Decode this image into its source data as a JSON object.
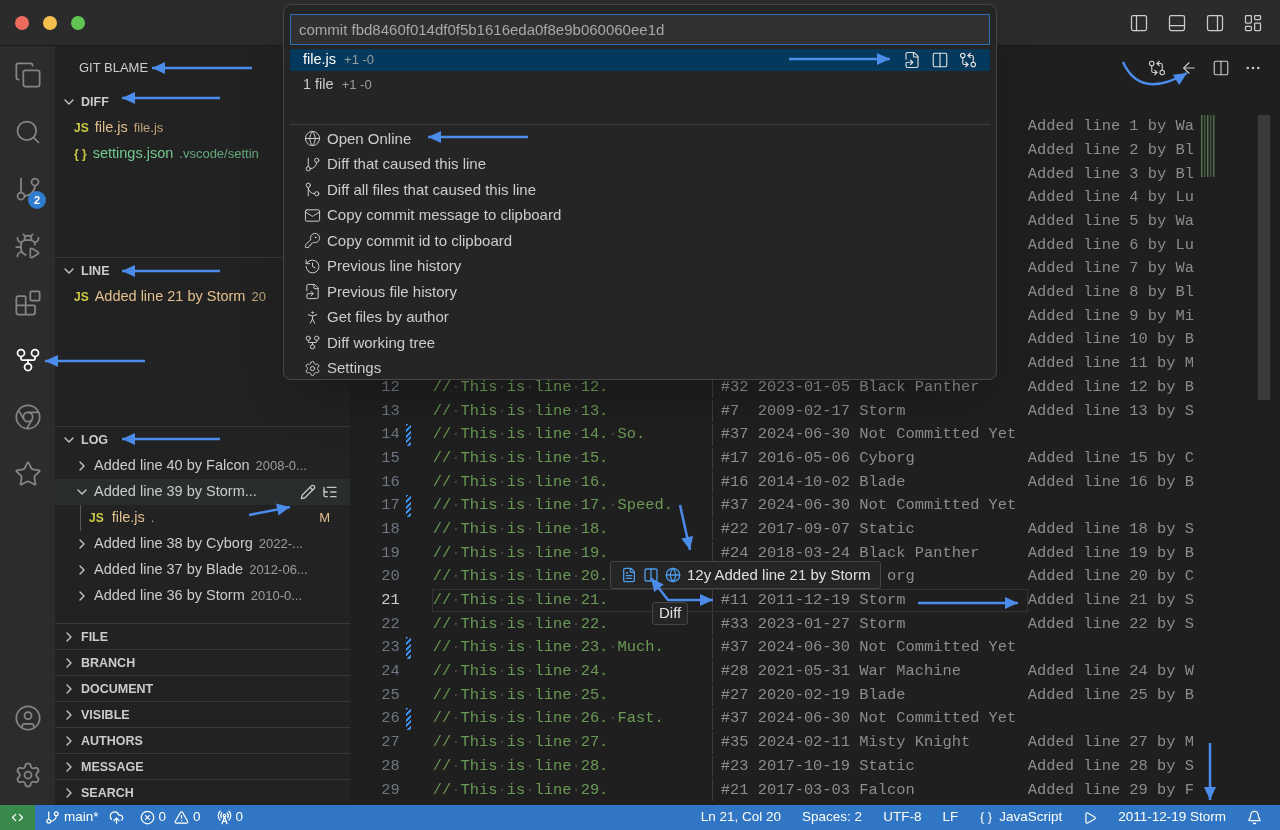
{
  "activity_bar": [
    {
      "kind": "files",
      "selected": false
    },
    {
      "kind": "search",
      "selected": false
    },
    {
      "kind": "source-control",
      "selected": false,
      "badge": "2"
    },
    {
      "kind": "run-debug",
      "selected": false
    },
    {
      "kind": "extensions",
      "selected": false
    },
    {
      "kind": "git-fork",
      "selected": true
    },
    {
      "kind": "ring",
      "selected": false
    },
    {
      "kind": "star",
      "selected": false
    }
  ],
  "activity_bar_bottom": [
    {
      "kind": "account"
    },
    {
      "kind": "settings"
    }
  ],
  "sidebar": {
    "title": "GIT BLAME",
    "sections": [
      {
        "title": "DIFF",
        "kind": "files",
        "expanded": true,
        "items": [
          {
            "icon": "JS",
            "name": "file.js",
            "detail": "file.js",
            "color": "#e2c08d"
          },
          {
            "icon": "{ }",
            "name": "settings.json",
            "detail": ".vscode/settin",
            "color": "#73c991"
          }
        ]
      },
      {
        "title": "LINE",
        "kind": "files",
        "expanded": true,
        "items": [
          {
            "icon": "JS",
            "name": "Added line 21 by Storm",
            "detail": "20",
            "color": "#e2c08d"
          }
        ]
      },
      {
        "title": "LOG",
        "kind": "commits",
        "expanded": true,
        "items": [
          {
            "label": "Added line 40 by Falcon",
            "detail": "2008-0...",
            "expanded": false,
            "selected": false
          },
          {
            "label": "Added line 39 by Storm...",
            "expanded": true,
            "selected": true,
            "children": [
              {
                "icon": "JS",
                "name": "file.js",
                "detail": ".",
                "status": "M"
              }
            ]
          },
          {
            "label": "Added line 38 by Cyborg",
            "detail": "2022-...",
            "expanded": false,
            "selected": false
          },
          {
            "label": "Added line 37 by Blade",
            "detail": "2012-06...",
            "expanded": false,
            "selected": false
          },
          {
            "label": "Added line 36 by Storm",
            "detail": "2010-0...",
            "expanded": false,
            "selected": false
          }
        ]
      },
      {
        "title": "FILE",
        "expanded": false
      },
      {
        "title": "BRANCH",
        "expanded": false
      },
      {
        "title": "DOCUMENT",
        "expanded": false
      },
      {
        "title": "VISIBLE",
        "expanded": false
      },
      {
        "title": "AUTHORS",
        "expanded": false
      },
      {
        "title": "MESSAGE",
        "expanded": false
      },
      {
        "title": "SEARCH",
        "expanded": false
      }
    ]
  },
  "command_palette": {
    "value": "commit fbd8460f014df0f5b1616eda0f8e9b060060ee1d",
    "files": [
      {
        "name": "file.js",
        "stats": "+1 -0",
        "selected": true
      },
      {
        "name": "1 file",
        "stats": "+1 -0",
        "selected": false
      }
    ],
    "actions": [
      {
        "kind": "globe",
        "label": "Open Online"
      },
      {
        "kind": "branch",
        "label": "Diff that caused this line"
      },
      {
        "kind": "merge",
        "label": "Diff all files that caused this line"
      },
      {
        "kind": "mail",
        "label": "Copy commit message to clipboard"
      },
      {
        "kind": "key",
        "label": "Copy commit id to clipboard"
      },
      {
        "kind": "history",
        "label": "Previous line history"
      },
      {
        "kind": "file-history",
        "label": "Previous file history"
      },
      {
        "kind": "person",
        "label": "Get files by author"
      },
      {
        "kind": "fork",
        "label": "Diff working tree"
      },
      {
        "kind": "settings",
        "label": "Settings"
      }
    ]
  },
  "editor": {
    "lines": [
      {
        "message": "Added line 1 by Wa"
      },
      {
        "message": "Added line 2 by Bl"
      },
      {
        "message": "Added line 3 by Bl"
      },
      {
        "message": "Added line 4 by Lu"
      },
      {
        "message": "Added line 5 by Wa"
      },
      {
        "message": "Added line 6 by Lu"
      },
      {
        "message": "Added line 7 by Wa"
      },
      {
        "message": "Added line 8 by Bl"
      },
      {
        "message": "Added line 9 by Mi"
      },
      {
        "message": "Added line 10 by B"
      },
      {
        "message": "Added line 11 by M"
      },
      {
        "number": "12",
        "code": "//·This·is·line·12.",
        "modified": false,
        "current": false,
        "blame": {
          "hash": "#32",
          "date": "2023-01-05",
          "author": "Black Panther"
        },
        "message": "Added line 12 by B"
      },
      {
        "number": "13",
        "code": "//·This·is·line·13.",
        "modified": false,
        "current": false,
        "blame": {
          "hash": "#7",
          "date": "2009-02-17",
          "author": "Storm"
        },
        "message": "Added line 13 by S"
      },
      {
        "number": "14",
        "code": "//·This·is·line·14.·So.",
        "modified": true,
        "current": false,
        "blame": {
          "hash": "#37",
          "date": "2024-06-30",
          "author": "Not Committed Yet"
        }
      },
      {
        "number": "15",
        "code": "//·This·is·line·15.",
        "modified": false,
        "current": false,
        "blame": {
          "hash": "#17",
          "date": "2016-05-06",
          "author": "Cyborg"
        },
        "message": "Added line 15 by C"
      },
      {
        "number": "16",
        "code": "//·This·is·line·16.",
        "modified": false,
        "current": false,
        "blame": {
          "hash": "#16",
          "date": "2014-10-02",
          "author": "Blade"
        },
        "message": "Added line 16 by B"
      },
      {
        "number": "17",
        "code": "//·This·is·line·17.·Speed.",
        "modified": true,
        "current": false,
        "blame": {
          "hash": "#37",
          "date": "2024-06-30",
          "author": "Not Committed Yet"
        }
      },
      {
        "number": "18",
        "code": "//·This·is·line·18.",
        "modified": false,
        "current": false,
        "blame": {
          "hash": "#22",
          "date": "2017-09-07",
          "author": "Static"
        },
        "message": "Added line 18 by S"
      },
      {
        "number": "19",
        "code": "//·This·is·line·19.",
        "modified": false,
        "current": false,
        "blame": {
          "hash": "#24",
          "date": "2018-03-24",
          "author": "Black Panther"
        },
        "message": "Added line 19 by B"
      },
      {
        "number": "20",
        "code": "//·This·is·line·20.",
        "modified": false,
        "current": false,
        "blame": {
          "author": "org"
        },
        "message": "Added line 20 by C"
      },
      {
        "number": "21",
        "code": "//·This·is·line·21.",
        "modified": false,
        "current": true,
        "blame": {
          "hash": "#11",
          "date": "2011-12-19",
          "author": "Storm"
        },
        "message": "Added line 21 by S"
      },
      {
        "number": "22",
        "code": "//·This·is·line·22.",
        "modified": false,
        "current": false,
        "blame": {
          "hash": "#33",
          "date": "2023-01-27",
          "author": "Storm"
        },
        "message": "Added line 22 by S"
      },
      {
        "number": "23",
        "code": "//·This·is·line·23.·Much.",
        "modified": true,
        "current": false,
        "blame": {
          "hash": "#37",
          "date": "2024-06-30",
          "author": "Not Committed Yet"
        }
      },
      {
        "number": "24",
        "code": "//·This·is·line·24.",
        "modified": false,
        "current": false,
        "blame": {
          "hash": "#28",
          "date": "2021-05-31",
          "author": "War Machine"
        },
        "message": "Added line 24 by W"
      },
      {
        "number": "25",
        "code": "//·This·is·line·25.",
        "modified": false,
        "current": false,
        "blame": {
          "hash": "#27",
          "date": "2020-02-19",
          "author": "Blade"
        },
        "message": "Added line 25 by B"
      },
      {
        "number": "26",
        "code": "//·This·is·line·26.·Fast.",
        "modified": true,
        "current": false,
        "blame": {
          "hash": "#37",
          "date": "2024-06-30",
          "author": "Not Committed Yet"
        }
      },
      {
        "number": "27",
        "code": "//·This·is·line·27.",
        "modified": false,
        "current": false,
        "blame": {
          "hash": "#35",
          "date": "2024-02-11",
          "author": "Misty Knight"
        },
        "message": "Added line 27 by M"
      },
      {
        "number": "28",
        "code": "//·This·is·line·28.",
        "modified": false,
        "current": false,
        "blame": {
          "hash": "#23",
          "date": "2017-10-19",
          "author": "Static"
        },
        "message": "Added line 28 by S"
      },
      {
        "number": "29",
        "code": "//·This·is·line·29.",
        "modified": false,
        "current": false,
        "blame": {
          "hash": "#21",
          "date": "2017-03-03",
          "author": "Falcon"
        },
        "message": "Added line 29 by F"
      }
    ],
    "hover": {
      "text": "12y Added line 21 by Storm"
    },
    "hover_tooltip": "Diff"
  },
  "status_bar": {
    "branch": "main*",
    "errors": "0",
    "warnings": "0",
    "ports": "0",
    "position": "Ln 21, Col 20",
    "indent": "Spaces: 2",
    "encoding": "UTF-8",
    "eol": "LF",
    "language": "JavaScript",
    "blame": "2011-12-19 Storm"
  }
}
